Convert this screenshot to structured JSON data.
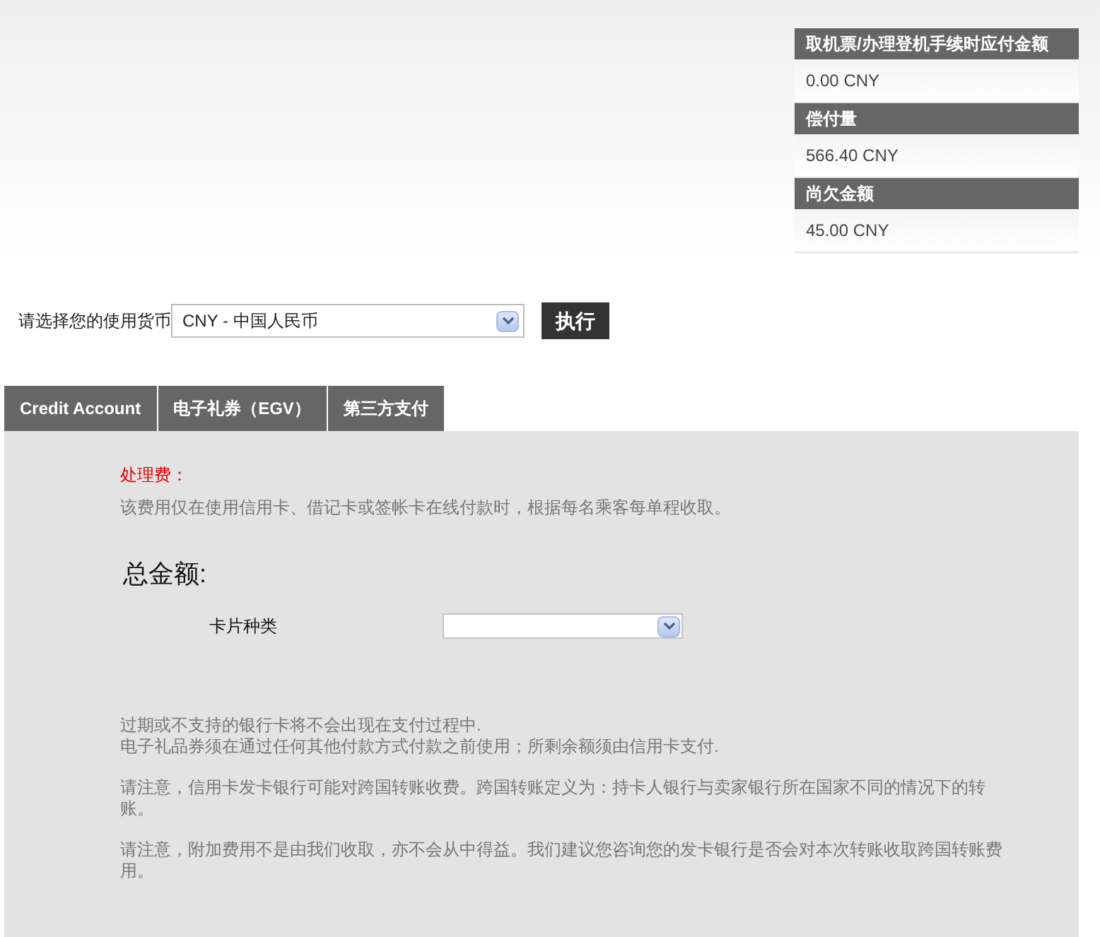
{
  "summary": [
    {
      "label": "取机票/办理登机手续时应付金额",
      "value": "0.00 CNY"
    },
    {
      "label": "偿付量",
      "value": "566.40 CNY"
    },
    {
      "label": "尚欠金额",
      "value": "45.00 CNY"
    }
  ],
  "currency": {
    "label": "请选择您的使用货币",
    "value": "CNY - 中国人民币",
    "button": "执行"
  },
  "tabs": [
    {
      "label": "Credit Account"
    },
    {
      "label": "电子礼券（EGV）"
    },
    {
      "label": "第三方支付"
    }
  ],
  "fee": {
    "title": "处理费：",
    "text": "该费用仅在使用信用卡、借记卡或签帐卡在线付款时，根据每名乘客每单程收取。"
  },
  "total": {
    "title": "总金额:"
  },
  "card_type": {
    "label": "卡片种类"
  },
  "notes": [
    [
      "过期或不支持的银行卡将不会出现在支付过程中.",
      "电子礼品券须在通过任何其他付款方式付款之前使用；所剩余额须由信用卡支付."
    ],
    [
      "请注意，信用卡发卡银行可能对跨国转账收费。跨国转账定义为：持卡人银行与卖家银行所在国家不同的情况下的转账。"
    ],
    [
      "请注意，附加费用不是由我们收取，亦不会从中得益。我们建议您咨询您的发卡银行是否会对本次转账收取跨国转账费用。"
    ]
  ]
}
